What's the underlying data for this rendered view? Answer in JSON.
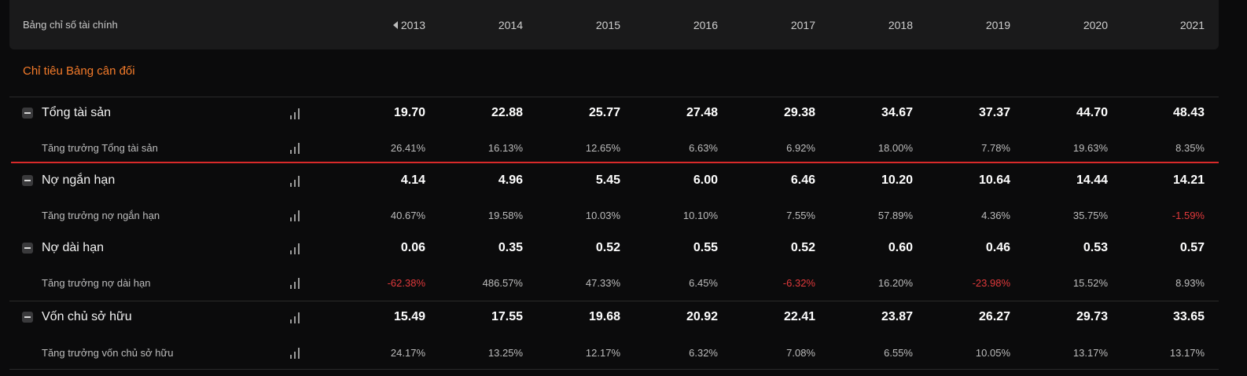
{
  "header": {
    "title": "Bảng chỉ số tài chính",
    "years": [
      "2013",
      "2014",
      "2015",
      "2016",
      "2017",
      "2018",
      "2019",
      "2020",
      "2021"
    ]
  },
  "section_title": "Chỉ tiêu Bảng cân đối",
  "colors": {
    "accent": "#f47b2a",
    "negative": "#e0393b",
    "highlight_line": "#d92a2a"
  },
  "icons": {
    "collapse": "minus-square-icon",
    "chart": "bar-chart-icon",
    "prev": "caret-left-icon"
  },
  "rows": [
    {
      "label": "Tổng tài sản",
      "type": "main",
      "values": [
        "19.70",
        "22.88",
        "25.77",
        "27.48",
        "29.38",
        "34.67",
        "37.37",
        "44.70",
        "48.43"
      ]
    },
    {
      "label": "Tăng trưởng Tổng tài sản",
      "type": "sub",
      "values": [
        "26.41%",
        "16.13%",
        "12.65%",
        "6.63%",
        "6.92%",
        "18.00%",
        "7.78%",
        "19.63%",
        "8.35%"
      ]
    },
    {
      "label": "Nợ ngắn hạn",
      "type": "main",
      "values": [
        "4.14",
        "4.96",
        "5.45",
        "6.00",
        "6.46",
        "10.20",
        "10.64",
        "14.44",
        "14.21"
      ]
    },
    {
      "label": "Tăng trưởng nợ ngắn hạn",
      "type": "sub",
      "values": [
        "40.67%",
        "19.58%",
        "10.03%",
        "10.10%",
        "7.55%",
        "57.89%",
        "4.36%",
        "35.75%",
        "-1.59%"
      ]
    },
    {
      "label": "Nợ dài hạn",
      "type": "main",
      "values": [
        "0.06",
        "0.35",
        "0.52",
        "0.55",
        "0.52",
        "0.60",
        "0.46",
        "0.53",
        "0.57"
      ]
    },
    {
      "label": "Tăng trưởng nợ dài hạn",
      "type": "sub",
      "values": [
        "-62.38%",
        "486.57%",
        "47.33%",
        "6.45%",
        "-6.32%",
        "16.20%",
        "-23.98%",
        "15.52%",
        "8.93%"
      ]
    },
    {
      "label": "Vốn chủ sở hữu",
      "type": "main",
      "values": [
        "15.49",
        "17.55",
        "19.68",
        "20.92",
        "22.41",
        "23.87",
        "26.27",
        "29.73",
        "33.65"
      ]
    },
    {
      "label": "Tăng trưởng vốn chủ sở hữu",
      "type": "sub",
      "values": [
        "24.17%",
        "13.25%",
        "12.17%",
        "6.32%",
        "7.08%",
        "6.55%",
        "10.05%",
        "13.17%",
        "13.17%"
      ]
    }
  ]
}
